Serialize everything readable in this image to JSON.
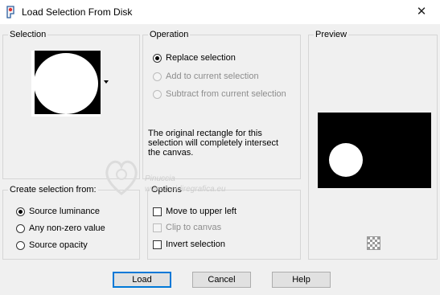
{
  "window": {
    "title": "Load Selection From Disk",
    "close_glyph": "✕"
  },
  "selection": {
    "label": "Selection",
    "thumbnail_dropdown_icon": "chevron-down-icon"
  },
  "operation": {
    "label": "Operation",
    "options": [
      {
        "label": "Replace selection",
        "checked": true,
        "enabled": true
      },
      {
        "label": "Add to current selection",
        "checked": false,
        "enabled": false
      },
      {
        "label": "Subtract from current selection",
        "checked": false,
        "enabled": false
      }
    ],
    "info_lines": [
      "The original rectangle for this",
      "selection will completely intersect",
      "the canvas."
    ]
  },
  "preview": {
    "label": "Preview",
    "zoom_icon": "checkerboard-icon"
  },
  "create_from": {
    "label": "Create selection from:",
    "options": [
      {
        "label": "Source luminance",
        "checked": true
      },
      {
        "label": "Any non-zero value",
        "checked": false
      },
      {
        "label": "Source opacity",
        "checked": false
      }
    ]
  },
  "options": {
    "label": "Options",
    "items": [
      {
        "label": "Move to upper left",
        "checked": false,
        "enabled": true
      },
      {
        "label": "Clip to canvas",
        "checked": false,
        "enabled": false
      },
      {
        "label": "Invert selection",
        "checked": false,
        "enabled": true
      }
    ]
  },
  "buttons": {
    "load": "Load",
    "cancel": "Cancel",
    "help": "Help"
  },
  "watermark": {
    "line1": "Pinuccia",
    "line2": "www.maidiregrafica.eu"
  },
  "colors": {
    "accent": "#0078d7",
    "background": "#f0f0f0"
  }
}
